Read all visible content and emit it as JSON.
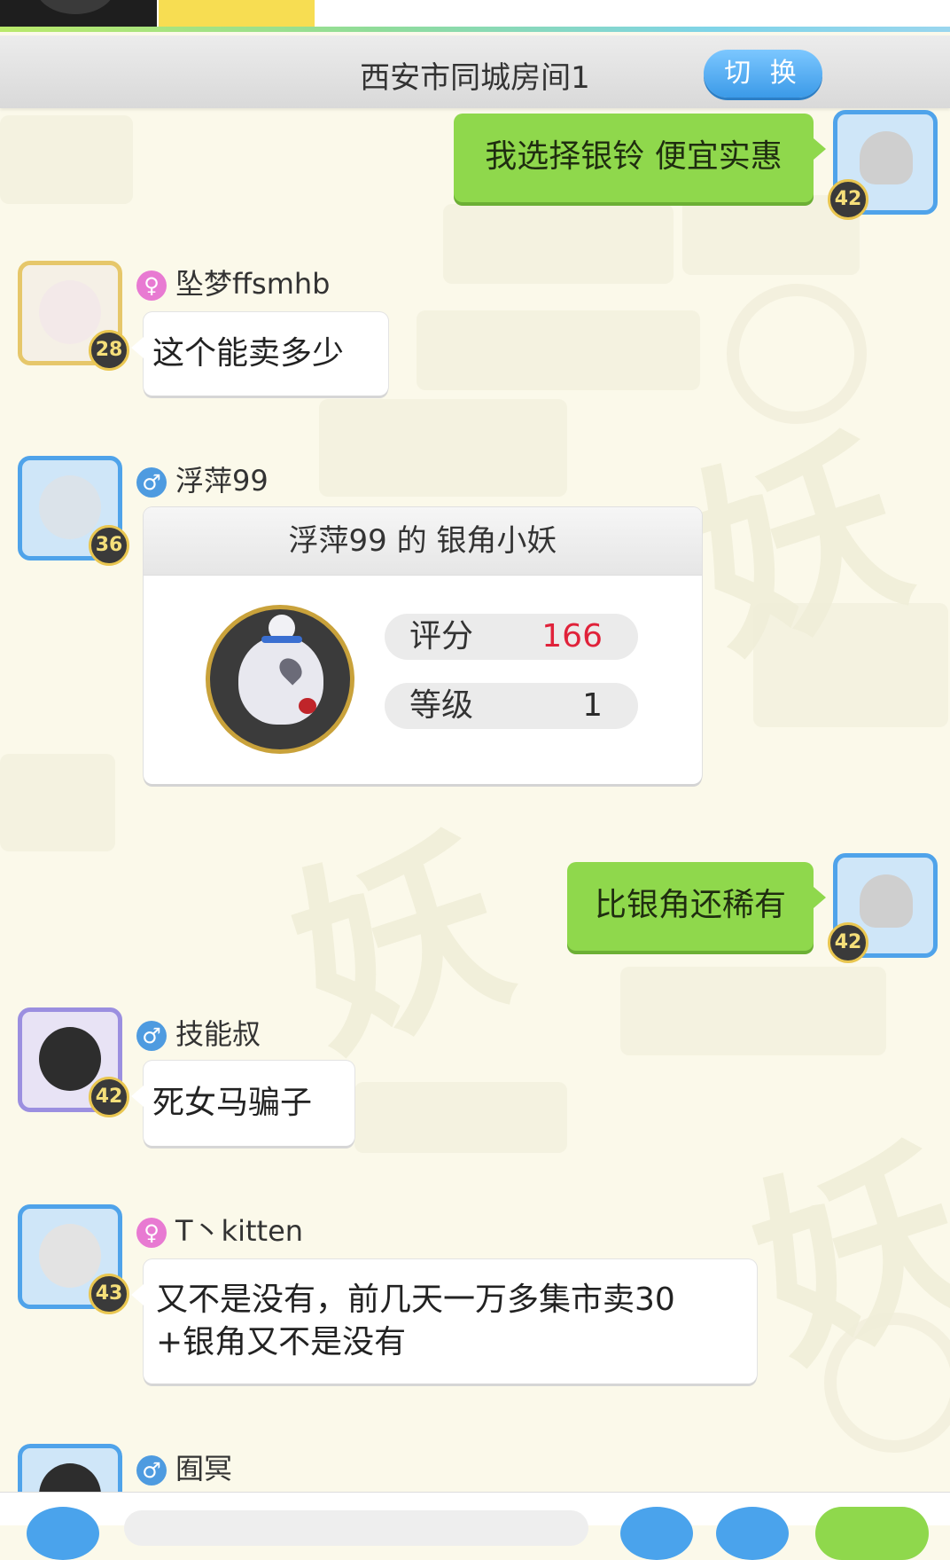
{
  "room": {
    "title": "西安市同城房间1",
    "switch_label": "切 换"
  },
  "messages": [
    {
      "mine": true,
      "text": "我选择银铃 便宜实惠",
      "level": "42"
    },
    {
      "sender": "坠梦ffsmhb",
      "gender": "female",
      "gender_icon": "♀",
      "level": "28",
      "text": "这个能卖多少"
    },
    {
      "sender": "浮萍99",
      "gender": "male",
      "gender_icon": "♂",
      "level": "36",
      "card": {
        "title": "浮萍99 的 银角小妖",
        "score_label": "评分",
        "score": "166",
        "level_label": "等级",
        "level": "1"
      }
    },
    {
      "mine": true,
      "text": "比银角还稀有",
      "level": "42"
    },
    {
      "sender": "技能叔",
      "gender": "male",
      "gender_icon": "♂",
      "level": "42",
      "text": "死女马骗子"
    },
    {
      "sender": "T丶kitten",
      "gender": "female",
      "gender_icon": "♀",
      "level": "43",
      "text_line1": "又不是没有，前几天一万多集市卖30",
      "text_line2": "+银角又不是没有"
    },
    {
      "sender": "囿冥",
      "gender": "male",
      "gender_icon": "♂"
    }
  ],
  "colors": {
    "accent_blue": "#4e9be0",
    "my_bubble": "#8fd84c",
    "score_red": "#e0223a"
  }
}
